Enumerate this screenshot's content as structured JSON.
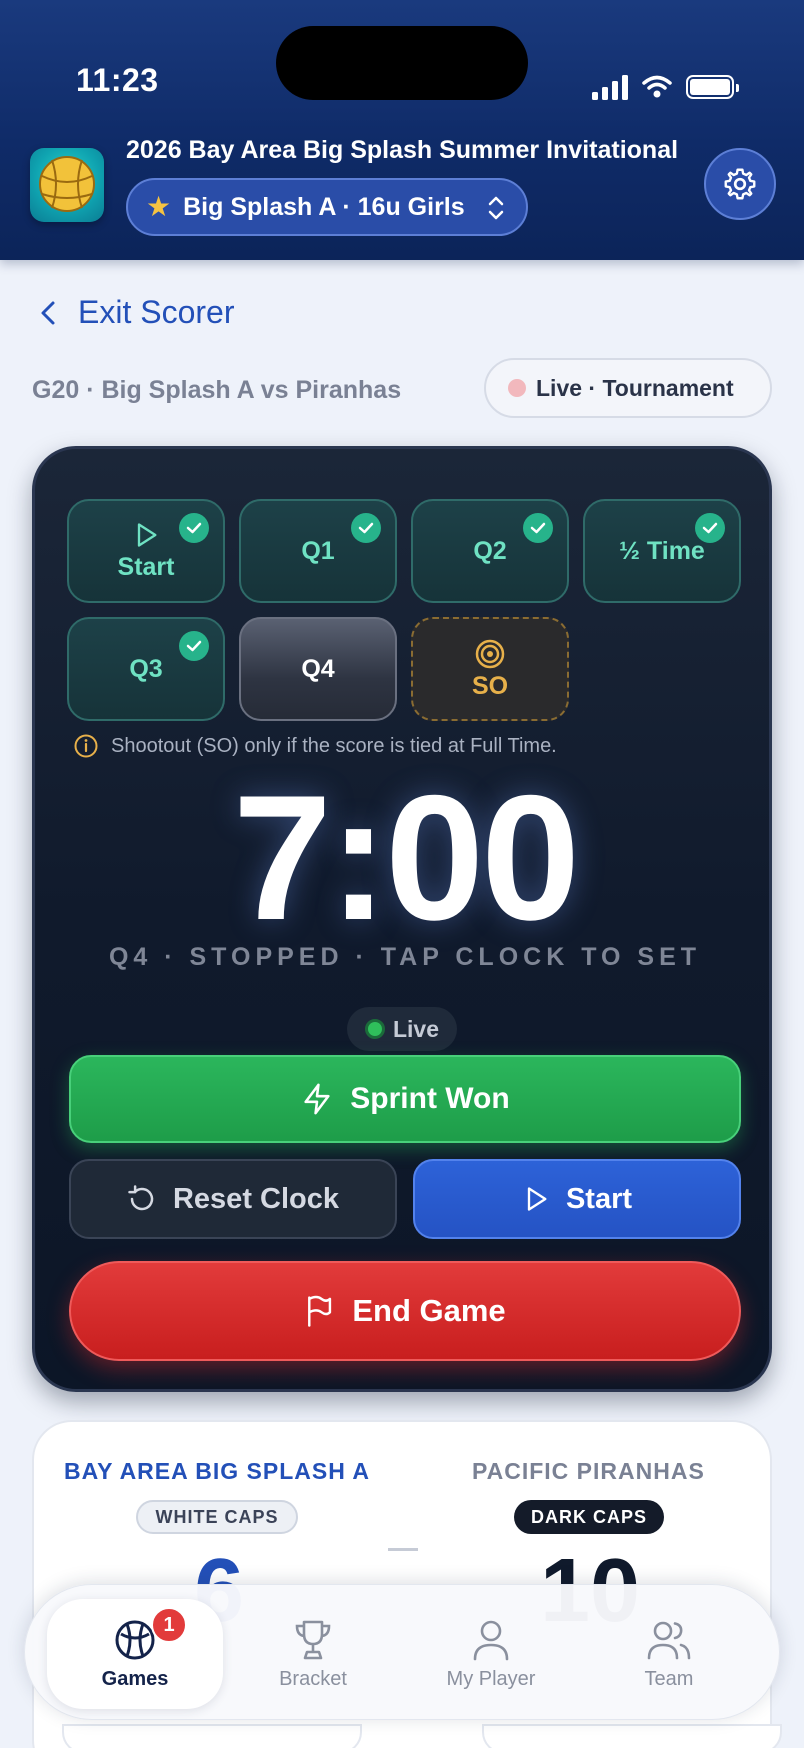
{
  "status_bar": {
    "time": "11:23"
  },
  "header": {
    "tournament_title": "2026 Bay Area Big Splash Summer Invitational",
    "team_selector_label": "Big Splash A · 16u Girls",
    "icons": [
      "volleyball-logo",
      "star-icon",
      "chevron-updown-icon",
      "gear-icon"
    ]
  },
  "nav": {
    "exit_label": "Exit Scorer"
  },
  "game": {
    "label": "G20 · Big Splash A vs Piranhas",
    "status_pill": "Live · Tournament"
  },
  "periods": [
    {
      "label": "Start",
      "done": true
    },
    {
      "label": "Q1",
      "done": true
    },
    {
      "label": "Q2",
      "done": true
    },
    {
      "label": "½ Time",
      "done": true
    },
    {
      "label": "Q3",
      "done": true
    },
    {
      "label": "Q4",
      "done": false,
      "active": true
    },
    {
      "label": "SO",
      "done": false
    }
  ],
  "info_note": "Shootout (SO) only if the score is tied at Full Time.",
  "clock": {
    "time": "7:00",
    "status": "Q4 · STOPPED · TAP CLOCK TO SET"
  },
  "live_chip": "Live",
  "actions": {
    "sprint_label": "Sprint Won",
    "reset_label": "Reset Clock",
    "start_label": "Start",
    "end_label": "End Game"
  },
  "scoreboard": {
    "home": {
      "name": "BAY AREA BIG SPLASH A",
      "caps": "WHITE CAPS",
      "score": "6"
    },
    "away": {
      "name": "PACIFIC PIRANHAS",
      "caps": "DARK CAPS",
      "score": "10"
    }
  },
  "bottom_nav": {
    "items": [
      {
        "label": "Games",
        "badge": "1",
        "active": true
      },
      {
        "label": "Bracket"
      },
      {
        "label": "My Player"
      },
      {
        "label": "Team"
      }
    ]
  },
  "colors": {
    "header_bg": "#0f2b68",
    "accent_blue": "#2350b8",
    "period_done": "#6fe2c3",
    "so_amber": "#e7b04a",
    "sprint_green": "#22a64f",
    "end_red": "#d42a2a"
  }
}
